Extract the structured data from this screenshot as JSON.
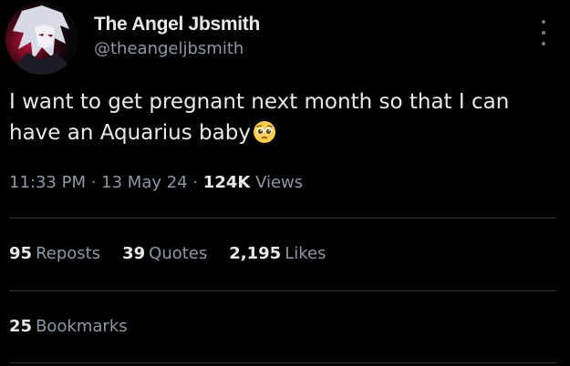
{
  "author": {
    "display_name": "The Angel Jbsmith",
    "handle": "@theangeljbsmith"
  },
  "tweet": {
    "text": "I want to get pregnant next month so that I can have an Aquarius baby",
    "emoji": "pleading-face"
  },
  "meta": {
    "time": "11:33 PM",
    "sep1": " · ",
    "date": "13 May 24",
    "sep2": " · ",
    "views_count": "124K",
    "views_label": "Views"
  },
  "stats": {
    "reposts_count": "95",
    "reposts_label": "Reposts",
    "quotes_count": "39",
    "quotes_label": "Quotes",
    "likes_count": "2,195",
    "likes_label": "Likes"
  },
  "bookmarks": {
    "count": "25",
    "label": "Bookmarks"
  },
  "colors": {
    "background": "#000000",
    "primary_text": "#e7e9ea",
    "secondary_text": "#8b98a5",
    "divider": "#2f3336"
  }
}
